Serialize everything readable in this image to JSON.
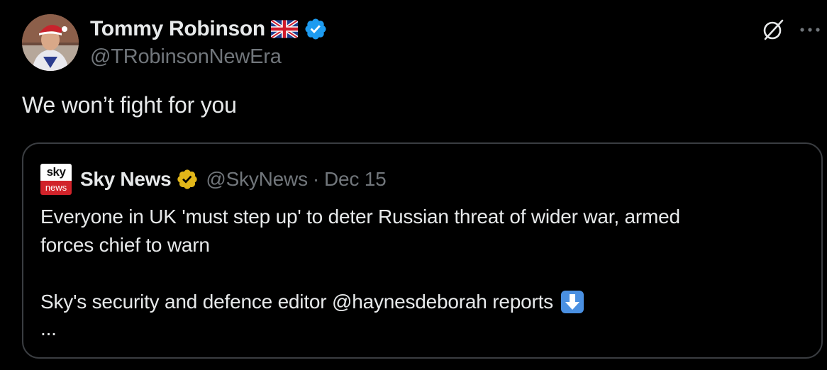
{
  "tweet": {
    "author_name": "Tommy Robinson",
    "author_handle": "@TRobinsonNewEra",
    "text": "We won’t fight for you",
    "icons": {
      "flag": "uk-flag-icon",
      "verified": "blue-verified-icon",
      "grok": "grok-icon",
      "more": "more-options-icon"
    }
  },
  "quote": {
    "author_name": "Sky News",
    "author_handle": "@SkyNews",
    "separator": "·",
    "date": "Dec 15",
    "logo": {
      "top": "sky",
      "bottom": "news"
    },
    "body_line1": "Everyone in UK 'must step up' to deter Russian threat of wider war, armed",
    "body_line2": "forces chief to warn",
    "body_para2": "Sky's security and defence editor @haynesdeborah reports",
    "ellipsis": "...",
    "icons": {
      "verified": "gold-verified-icon",
      "arrow": "down-arrow-emoji-icon"
    }
  },
  "colors": {
    "background": "#000000",
    "text_primary": "#e7e9ea",
    "text_secondary": "#71767b",
    "border": "#3a3d41",
    "blue_verified": "#1d9bf0",
    "gold_verified": "#e2b719",
    "sky_red": "#d1232a"
  }
}
